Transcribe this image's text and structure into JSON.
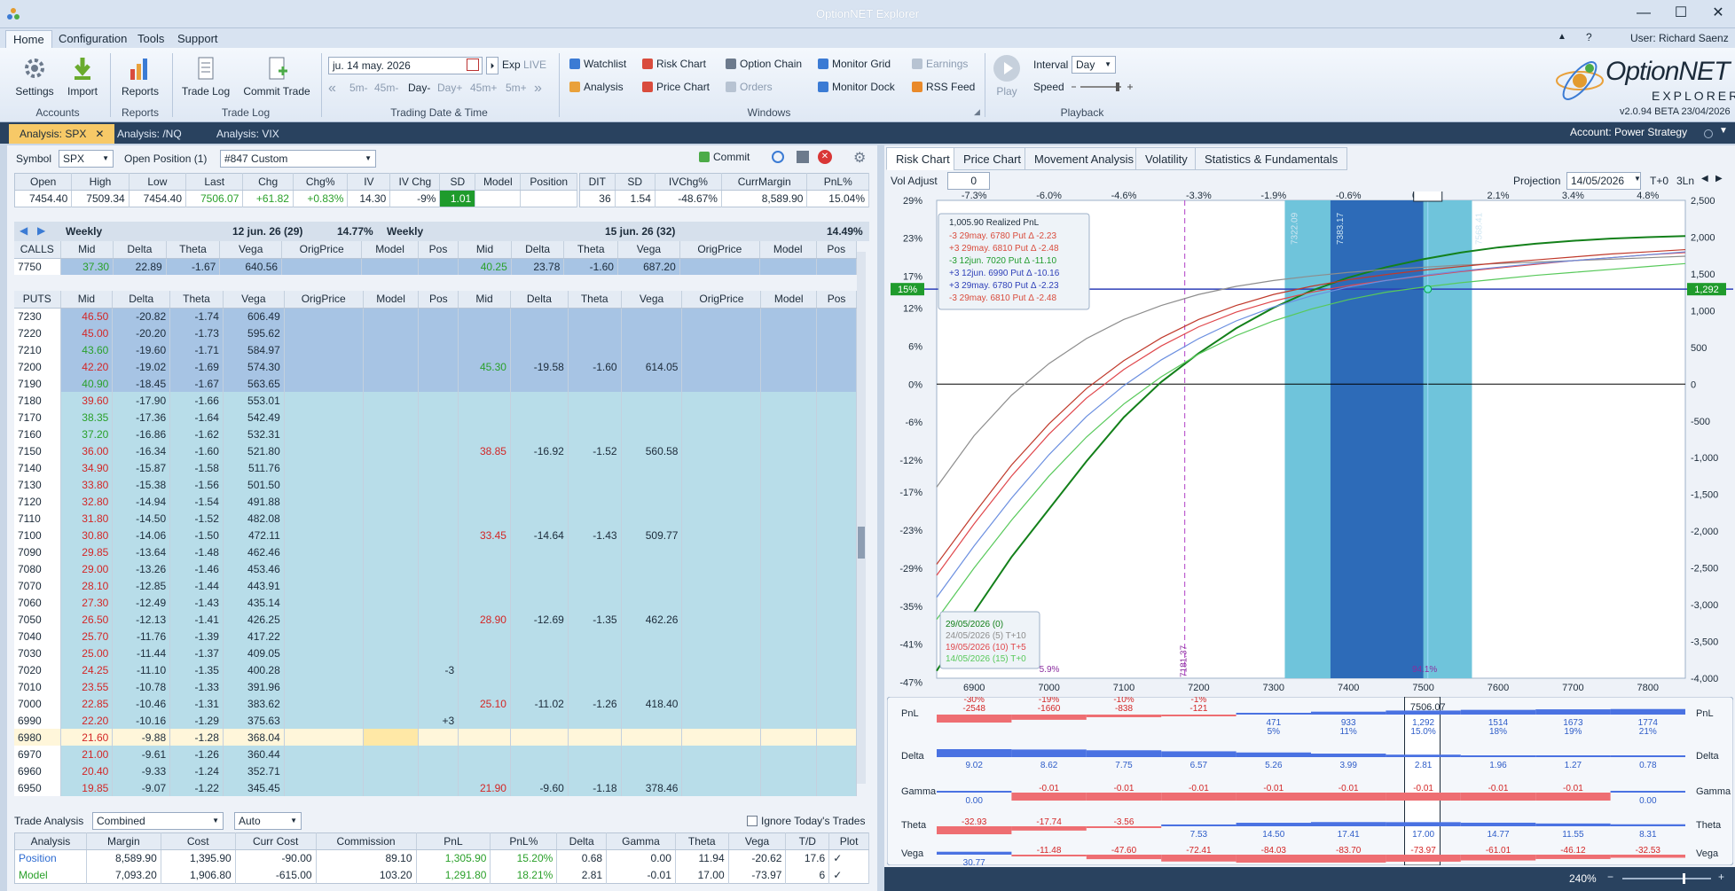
{
  "window": {
    "title": "OptionNET Explorer",
    "min": "—",
    "max": "☐",
    "close": "✕"
  },
  "menu": [
    "Home",
    "Configuration",
    "Tools",
    "Support"
  ],
  "user": "User: Richard Saenz",
  "ribbon": {
    "accounts": {
      "buttons": [
        "Settings",
        "Import"
      ],
      "group": "Accounts"
    },
    "reports": {
      "buttons": [
        "Reports"
      ],
      "group": "Reports"
    },
    "tradelog": {
      "buttons": [
        "Trade Log",
        "Commit Trade"
      ],
      "group": "Trade Log"
    },
    "trading": {
      "date": "ju. 14 may. 2026",
      "exp": "Exp",
      "live": "LIVE",
      "steps": [
        "5m-",
        "45m-",
        "Day-",
        "Day+",
        "45m+",
        "5m+"
      ],
      "group": "Trading Date & Time"
    },
    "windows": {
      "items": [
        "Watchlist",
        "Risk Chart",
        "Option Chain",
        "Monitor Grid",
        "Earnings",
        "Analysis",
        "Price Chart",
        "Orders",
        "Monitor Dock",
        "RSS Feed"
      ],
      "group": "Windows"
    },
    "playback": {
      "play": "Play",
      "interval_label": "Interval",
      "interval": "Day",
      "speed_label": "Speed",
      "group": "Playback"
    },
    "logo": {
      "name": "OptionNET",
      "sub": "EXPLORER",
      "version": "v2.0.94 BETA 23/04/2026"
    }
  },
  "doc_tabs": [
    "Analysis: SPX",
    "Analysis: /NQ",
    "Analysis: VIX"
  ],
  "account": "Account: Power Strategy",
  "left": {
    "symbol_label": "Symbol",
    "symbol": "SPX",
    "open_position": "Open Position (1)",
    "position_name": "#847 Custom",
    "commit": "Commit",
    "quote_headers": [
      "Open",
      "High",
      "Low",
      "Last",
      "Chg",
      "Chg%",
      "IV",
      "IV Chg",
      "SD",
      "Model",
      "Position"
    ],
    "quote": [
      "7454.40",
      "7509.34",
      "7454.40",
      "7506.07",
      "+61.82",
      "+0.83%",
      "14.30",
      "-9%",
      "1.01",
      "",
      ""
    ],
    "quote2_headers": [
      "DIT",
      "SD",
      "IVChg%",
      "CurrMargin",
      "PnL%"
    ],
    "quote2": [
      "36",
      "1.54",
      "-48.67%",
      "8,589.90",
      "15.04%"
    ],
    "chain1": {
      "name": "Weekly",
      "exp": "12 jun. 26 (29)",
      "iv": "14.77%"
    },
    "chain2": {
      "name": "Weekly",
      "exp": "15 jun. 26 (32)",
      "iv": "14.49%"
    },
    "cols": [
      "Mid",
      "Delta",
      "Theta",
      "Vega",
      "OrigPrice",
      "Model",
      "Pos"
    ],
    "calls_label": "CALLS",
    "puts_label": "PUTS",
    "calls": [
      {
        "strike": "7750",
        "mid": "37.30",
        "delta": "22.89",
        "theta": "-1.67",
        "vega": "640.56",
        "mid2": "40.25",
        "delta2": "23.78",
        "theta2": "-1.60",
        "vega2": "687.20"
      }
    ],
    "puts": [
      {
        "s": "7230",
        "m": "46.50",
        "d": "-20.82",
        "t": "-1.74",
        "v": "606.49",
        "c": "r",
        "b": 1
      },
      {
        "s": "7220",
        "m": "45.00",
        "d": "-20.20",
        "t": "-1.73",
        "v": "595.62",
        "c": "r",
        "b": 1
      },
      {
        "s": "7210",
        "m": "43.60",
        "d": "-19.60",
        "t": "-1.71",
        "v": "584.97",
        "c": "g",
        "b": 1
      },
      {
        "s": "7200",
        "m": "42.20",
        "d": "-19.02",
        "t": "-1.69",
        "v": "574.30",
        "c": "r",
        "b": 1,
        "m2": "45.30",
        "d2": "-19.58",
        "t2": "-1.60",
        "v2": "614.05",
        "c2": "g"
      },
      {
        "s": "7190",
        "m": "40.90",
        "d": "-18.45",
        "t": "-1.67",
        "v": "563.65",
        "c": "g",
        "b": 1
      },
      {
        "s": "7180",
        "m": "39.60",
        "d": "-17.90",
        "t": "-1.66",
        "v": "553.01",
        "c": "r"
      },
      {
        "s": "7170",
        "m": "38.35",
        "d": "-17.36",
        "t": "-1.64",
        "v": "542.49",
        "c": "g"
      },
      {
        "s": "7160",
        "m": "37.20",
        "d": "-16.86",
        "t": "-1.62",
        "v": "532.31",
        "c": "g"
      },
      {
        "s": "7150",
        "m": "36.00",
        "d": "-16.34",
        "t": "-1.60",
        "v": "521.80",
        "c": "r",
        "m2": "38.85",
        "d2": "-16.92",
        "t2": "-1.52",
        "v2": "560.58",
        "c2": "r"
      },
      {
        "s": "7140",
        "m": "34.90",
        "d": "-15.87",
        "t": "-1.58",
        "v": "511.76",
        "c": "r"
      },
      {
        "s": "7130",
        "m": "33.80",
        "d": "-15.38",
        "t": "-1.56",
        "v": "501.50",
        "c": "r"
      },
      {
        "s": "7120",
        "m": "32.80",
        "d": "-14.94",
        "t": "-1.54",
        "v": "491.88",
        "c": "r"
      },
      {
        "s": "7110",
        "m": "31.80",
        "d": "-14.50",
        "t": "-1.52",
        "v": "482.08",
        "c": "r"
      },
      {
        "s": "7100",
        "m": "30.80",
        "d": "-14.06",
        "t": "-1.50",
        "v": "472.11",
        "c": "r",
        "m2": "33.45",
        "d2": "-14.64",
        "t2": "-1.43",
        "v2": "509.77",
        "c2": "r"
      },
      {
        "s": "7090",
        "m": "29.85",
        "d": "-13.64",
        "t": "-1.48",
        "v": "462.46",
        "c": "r"
      },
      {
        "s": "7080",
        "m": "29.00",
        "d": "-13.26",
        "t": "-1.46",
        "v": "453.46",
        "c": "r"
      },
      {
        "s": "7070",
        "m": "28.10",
        "d": "-12.85",
        "t": "-1.44",
        "v": "443.91",
        "c": "r"
      },
      {
        "s": "7060",
        "m": "27.30",
        "d": "-12.49",
        "t": "-1.43",
        "v": "435.14",
        "c": "r"
      },
      {
        "s": "7050",
        "m": "26.50",
        "d": "-12.13",
        "t": "-1.41",
        "v": "426.25",
        "c": "r",
        "m2": "28.90",
        "d2": "-12.69",
        "t2": "-1.35",
        "v2": "462.26",
        "c2": "r"
      },
      {
        "s": "7040",
        "m": "25.70",
        "d": "-11.76",
        "t": "-1.39",
        "v": "417.22",
        "c": "r"
      },
      {
        "s": "7030",
        "m": "25.00",
        "d": "-11.44",
        "t": "-1.37",
        "v": "409.05",
        "c": "r"
      },
      {
        "s": "7020",
        "m": "24.25",
        "d": "-11.10",
        "t": "-1.35",
        "v": "400.28",
        "c": "r",
        "pos": "-3"
      },
      {
        "s": "7010",
        "m": "23.55",
        "d": "-10.78",
        "t": "-1.33",
        "v": "391.96",
        "c": "r"
      },
      {
        "s": "7000",
        "m": "22.85",
        "d": "-10.46",
        "t": "-1.31",
        "v": "383.62",
        "c": "r",
        "m2": "25.10",
        "d2": "-11.02",
        "t2": "-1.26",
        "v2": "418.40",
        "c2": "r"
      },
      {
        "s": "6990",
        "m": "22.20",
        "d": "-10.16",
        "t": "-1.29",
        "v": "375.63",
        "c": "r",
        "pos": "+3"
      },
      {
        "s": "6980",
        "m": "21.60",
        "d": "-9.88",
        "t": "-1.28",
        "v": "368.04",
        "c": "r",
        "y": 1
      },
      {
        "s": "6970",
        "m": "21.00",
        "d": "-9.61",
        "t": "-1.26",
        "v": "360.44",
        "c": "r"
      },
      {
        "s": "6960",
        "m": "20.40",
        "d": "-9.33",
        "t": "-1.24",
        "v": "352.71",
        "c": "r"
      },
      {
        "s": "6950",
        "m": "19.85",
        "d": "-9.07",
        "t": "-1.22",
        "v": "345.45",
        "c": "r",
        "m2": "21.90",
        "d2": "-9.60",
        "t2": "-1.18",
        "v2": "378.46",
        "c2": "r"
      }
    ],
    "trade_analysis": {
      "label": "Trade Analysis",
      "mode": "Combined",
      "auto": "Auto",
      "ignore": "Ignore Today's Trades",
      "headers": [
        "Analysis",
        "Margin",
        "Cost",
        "Curr Cost",
        "Commission",
        "PnL",
        "PnL%",
        "Delta",
        "Gamma",
        "Theta",
        "Vega",
        "T/D",
        "Plot"
      ],
      "rows": [
        [
          "Position",
          "8,589.90",
          "1,395.90",
          "-90.00",
          "89.10",
          "1,305.90",
          "15.20%",
          "0.68",
          "0.00",
          "11.94",
          "-20.62",
          "17.6",
          "✓"
        ],
        [
          "Model",
          "7,093.20",
          "1,906.80",
          "-615.00",
          "103.20",
          "1,291.80",
          "18.21%",
          "2.81",
          "-0.01",
          "17.00",
          "-73.97",
          "6",
          "✓"
        ]
      ]
    }
  },
  "right": {
    "tabs": [
      "Risk Chart",
      "Price Chart",
      "Movement Analysis",
      "Volatility",
      "Statistics & Fundamentals"
    ],
    "vol_adjust_label": "Vol Adjust",
    "vol_adjust": "0",
    "projection_label": "Projection",
    "projection": "14/05/2026",
    "tplus": "T+0",
    "lines": "3Ln",
    "legend": {
      "title": "1,005.90 Realized PnL",
      "items": [
        "-3 29may. 6780 Put Δ -2.23",
        "+3 29may. 6810 Put Δ -2.48",
        "-3 12jun. 7020 Put Δ -11.10",
        "+3 12jun. 6990 Put Δ -10.16",
        "+3 29may. 6780 Put Δ -2.23",
        "-3 29may. 6810 Put Δ -2.48"
      ]
    },
    "dates": [
      "29/05/2026 (0)",
      "24/05/2026 (5) T+10",
      "19/05/2026 (10) T+5",
      "14/05/2026 (15) T+0"
    ],
    "left_pct_badge": "15%",
    "right_val_badge": "1,292",
    "current_price": "7506.07",
    "sd_labels": [
      "7322.09",
      "7383.17",
      "7568.41"
    ],
    "pct_low": "5.9%",
    "pct_high": "94.1%",
    "strike_line": "7181.37",
    "top_pct": [
      "-7.3%",
      "-6.0%",
      "-4.6%",
      "-3.3%",
      "-1.9%",
      "-0.6%",
      "0.8%",
      "2.1%",
      "3.4%",
      "4.8%"
    ],
    "y_left": [
      "29%",
      "23%",
      "17%",
      "12%",
      "6%",
      "0%",
      "-6%",
      "-12%",
      "-17%",
      "-23%",
      "-29%",
      "-35%",
      "-41%",
      "-47%"
    ],
    "y_right": [
      "2,500",
      "2,000",
      "1,500",
      "1,000",
      "500",
      "0",
      "-500",
      "-1,000",
      "-1,500",
      "-2,000",
      "-2,500",
      "-3,000",
      "-3,500",
      "-4,000"
    ],
    "x_labels": [
      "6900",
      "7000",
      "7100",
      "7200",
      "7300",
      "7400",
      "7500",
      "7600",
      "7700",
      "7800"
    ],
    "stats": {
      "pnl_label": "PnL",
      "pnl_pct": [
        "-30%",
        "-19%",
        "-10%",
        "-1%",
        "5%",
        "11%",
        "15.0%",
        "18%",
        "19%",
        "21%"
      ],
      "pnl": [
        "-2548",
        "-1660",
        "-838",
        "-121",
        "471",
        "933",
        "1,292",
        "1514",
        "1673",
        "1774"
      ],
      "delta_label": "Delta",
      "delta": [
        "9.02",
        "8.62",
        "7.75",
        "6.57",
        "5.26",
        "3.99",
        "2.81",
        "1.96",
        "1.27",
        "0.78"
      ],
      "gamma_label": "Gamma",
      "gamma": [
        "0.00",
        "-0.01",
        "-0.01",
        "-0.01",
        "-0.01",
        "-0.01",
        "-0.01",
        "-0.01",
        "-0.01",
        "0.00"
      ],
      "theta_label": "Theta",
      "theta": [
        "-32.93",
        "-17.74",
        "-3.56",
        "7.53",
        "14.50",
        "17.41",
        "17.00",
        "14.77",
        "11.55",
        "8.31"
      ],
      "vega_label": "Vega",
      "vega": [
        "30.77",
        "-11.48",
        "-47.60",
        "-72.41",
        "-84.03",
        "-83.70",
        "-73.97",
        "-61.01",
        "-46.12",
        "-32.53"
      ]
    },
    "zoom": "240%"
  },
  "chart_data": {
    "type": "line",
    "x": [
      6850,
      6900,
      6950,
      7000,
      7050,
      7100,
      7150,
      7200,
      7250,
      7300,
      7350,
      7400,
      7450,
      7500,
      7550,
      7600,
      7650,
      7700,
      7750,
      7800,
      7850
    ],
    "xlim": [
      6850,
      7850
    ],
    "ylim": [
      -4000,
      2500
    ],
    "series": [
      {
        "name": "29/05/2026 (0)",
        "color": "#13801a",
        "values": [
          -3900,
          -3100,
          -2350,
          -1700,
          -1050,
          -450,
          30,
          420,
          760,
          1040,
          1270,
          1450,
          1590,
          1700,
          1790,
          1860,
          1910,
          1950,
          1980,
          2000,
          2015
        ]
      },
      {
        "name": "24/05/2026 (5) T+10",
        "color": "#8d8d8d",
        "values": [
          -1400,
          -700,
          -150,
          280,
          620,
          880,
          1070,
          1220,
          1330,
          1410,
          1470,
          1520,
          1560,
          1590,
          1620,
          1640,
          1660,
          1680,
          1700,
          1720,
          1740
        ]
      },
      {
        "name": "19/05/2026 (10) T+5",
        "color": "#e0474c",
        "values": [
          -2600,
          -1900,
          -1250,
          -680,
          -190,
          200,
          520,
          780,
          980,
          1130,
          1250,
          1340,
          1410,
          1470,
          1530,
          1580,
          1630,
          1680,
          1720,
          1760,
          1790
        ]
      },
      {
        "name": "14/05/2026 (15) T+0",
        "color": "#58c95b",
        "values": [
          -3200,
          -2500,
          -1850,
          -1250,
          -720,
          -270,
          100,
          410,
          660,
          860,
          1020,
          1150,
          1250,
          1320,
          1380,
          1430,
          1480,
          1520,
          1560,
          1600,
          1640
        ]
      },
      {
        "color": "#6b8fe0",
        "values": [
          -2900,
          -2200,
          -1550,
          -960,
          -440,
          -20,
          330,
          620,
          860,
          1050,
          1200,
          1320,
          1410,
          1480,
          1540,
          1590,
          1640,
          1680,
          1720,
          1760,
          1800
        ]
      },
      {
        "color": "#c0392b",
        "values": [
          -2450,
          -1760,
          -1100,
          -540,
          -60,
          320,
          630,
          880,
          1070,
          1220,
          1330,
          1420,
          1490,
          1550,
          1600,
          1650,
          1690,
          1730,
          1770,
          1800,
          1830
        ]
      }
    ]
  }
}
